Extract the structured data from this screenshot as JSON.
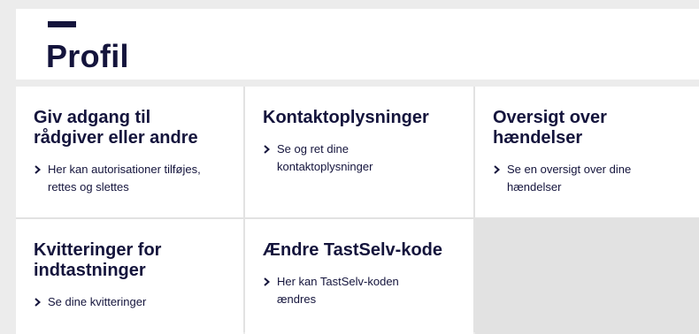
{
  "page": {
    "title": "Profil"
  },
  "cards": [
    {
      "title": "Giv adgang til rådgiver eller andre",
      "link": "Her kan autorisationer tilføjes, rettes og slettes"
    },
    {
      "title": "Kontaktoplysninger",
      "link": "Se og ret dine kontaktoplysninger"
    },
    {
      "title": "Oversigt over hændelser",
      "link": "Se en oversigt over dine hændelser"
    },
    {
      "title": "Kvitteringer for indtastninger",
      "link": "Se dine kvitteringer"
    },
    {
      "title": "Ændre TastSelv-kode",
      "link": "Her kan TastSelv-koden ændres"
    }
  ],
  "colors": {
    "text": "#14143c",
    "background": "#ececec",
    "card": "#ffffff"
  }
}
